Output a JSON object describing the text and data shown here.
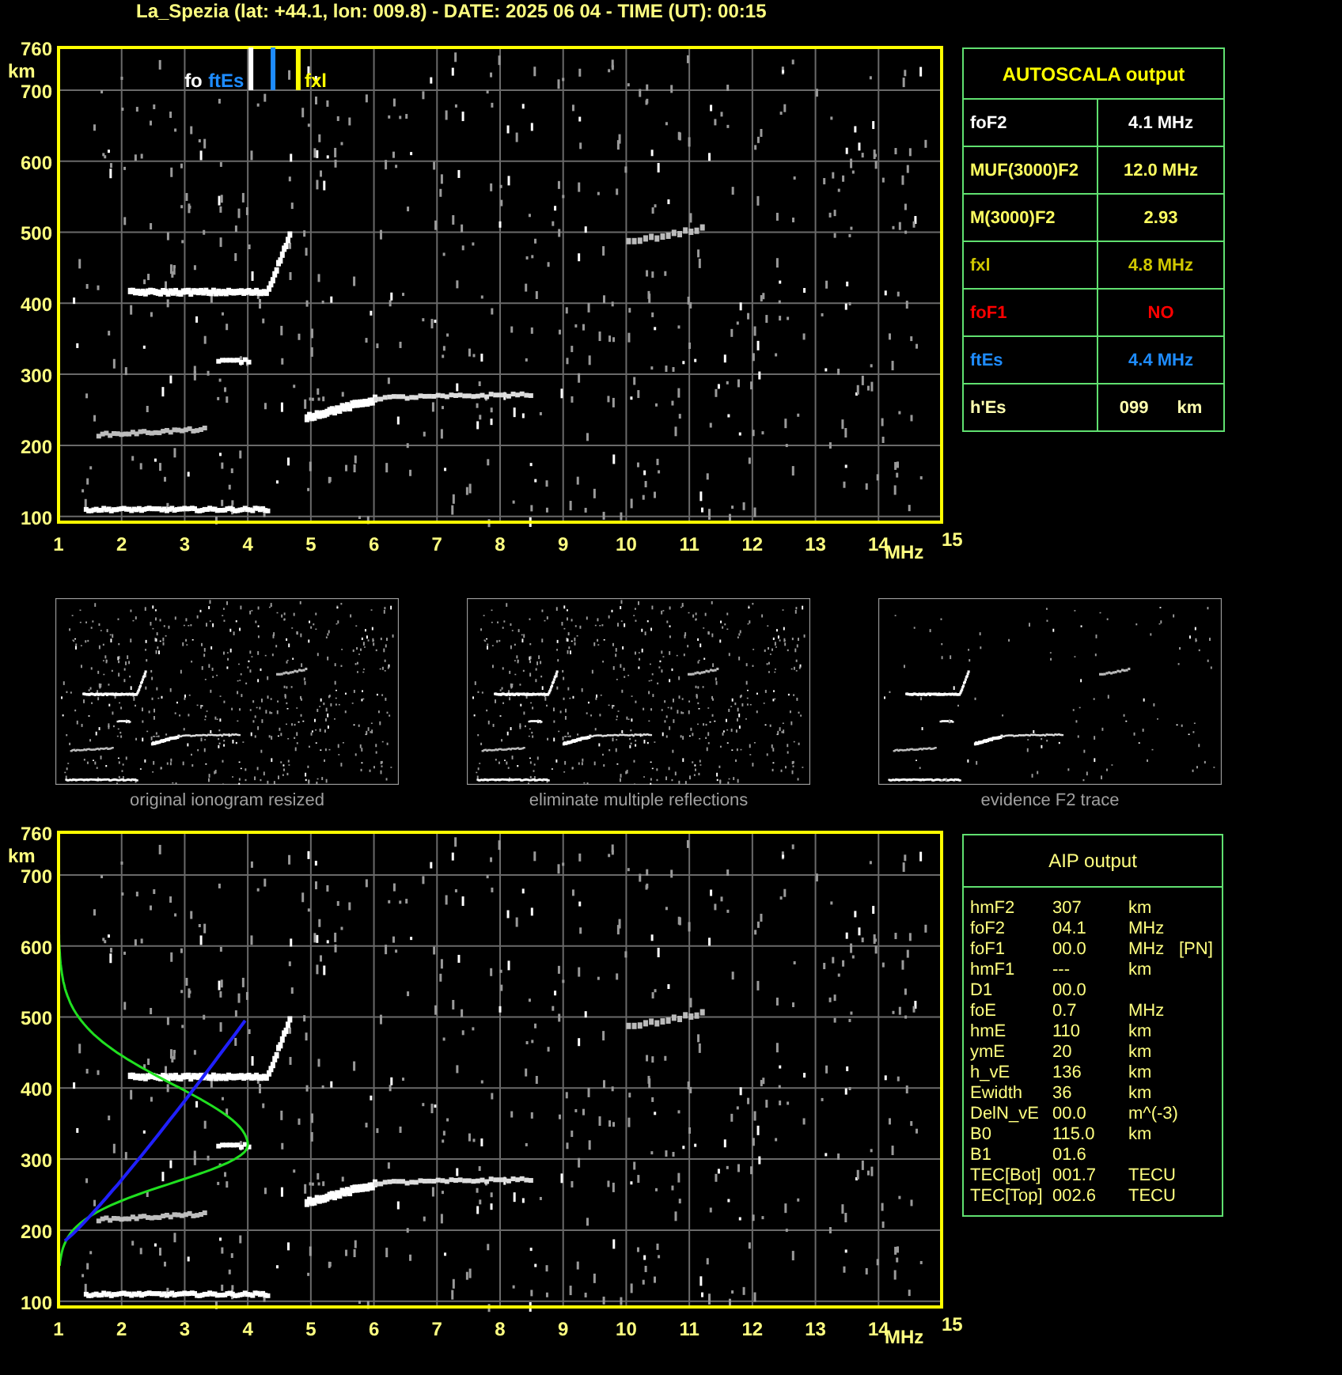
{
  "title": "La_Spezia (lat: +44.1, lon: 009.8) - DATE: 2025 06 04 - TIME (UT): 00:15",
  "ionograms": [
    {
      "kind": "scaled",
      "y_unit": "km",
      "x_unit": "MHz",
      "y_ticks": [
        "760",
        "700",
        "600",
        "500",
        "400",
        "300",
        "200",
        "100"
      ],
      "x_ticks": [
        "1",
        "2",
        "3",
        "4",
        "5",
        "6",
        "7",
        "8",
        "9",
        "10",
        "11",
        "12",
        "13",
        "14",
        "15"
      ],
      "markers": [
        {
          "label": "fo",
          "color": "#ffffff"
        },
        {
          "label": "ftEs",
          "color": "#1e8cff"
        },
        {
          "label": "fxl",
          "color": "#ffff00"
        }
      ]
    },
    {
      "kind": "profile",
      "y_unit": "km",
      "x_unit": "MHz",
      "y_ticks": [
        "760",
        "700",
        "600",
        "500",
        "400",
        "300",
        "200",
        "100"
      ],
      "x_ticks": [
        "1",
        "2",
        "3",
        "4",
        "5",
        "6",
        "7",
        "8",
        "9",
        "10",
        "11",
        "12",
        "13",
        "14",
        "15"
      ]
    }
  ],
  "autoscala": {
    "title": "AUTOSCALA output",
    "rows": [
      {
        "label": "foF2",
        "value": "4.1 MHz",
        "color": "#ffffff"
      },
      {
        "label": "MUF(3000)F2",
        "value": "12.0 MHz",
        "color": "#ffff60"
      },
      {
        "label": "M(3000)F2",
        "value": "2.93",
        "color": "#ffff60"
      },
      {
        "label": "fxl",
        "value": "4.8 MHz",
        "color": "#d0c800"
      },
      {
        "label": "foF1",
        "value": "NO",
        "color": "#ff0000"
      },
      {
        "label": "ftEs",
        "value": "4.4 MHz",
        "color": "#1e8cff"
      },
      {
        "label": "h'Es",
        "value": "099",
        "unit": "km",
        "color": "#ffffb0"
      }
    ]
  },
  "thumbnails": [
    {
      "kind": "full",
      "caption": "original ionogram resized"
    },
    {
      "kind": "full",
      "caption": "eliminate multiple reflections"
    },
    {
      "kind": "trace",
      "caption": "evidence F2 trace"
    }
  ],
  "aip": {
    "title": "AIP output",
    "rows": [
      {
        "name": "hmF2",
        "value": "307",
        "unit": "km"
      },
      {
        "name": "foF2",
        "value": "04.1",
        "unit": "MHz"
      },
      {
        "name": "foF1",
        "value": "00.0",
        "unit": "MHz",
        "note": "[PN]"
      },
      {
        "name": "hmF1",
        "value": "---",
        "unit": "km"
      },
      {
        "name": "D1",
        "value": "00.0"
      },
      {
        "name": "foE",
        "value": "0.7",
        "unit": "MHz"
      },
      {
        "name": "hmE",
        "value": "110",
        "unit": "km"
      },
      {
        "name": "ymE",
        "value": "20",
        "unit": "km"
      },
      {
        "name": "h_vE",
        "value": "136",
        "unit": "km"
      },
      {
        "name": "Ewidth",
        "value": "36",
        "unit": "km"
      },
      {
        "name": "DelN_vE",
        "value": "00.0",
        "unit": "m^(-3)"
      },
      {
        "name": "B0",
        "value": "115.0",
        "unit": "km"
      },
      {
        "name": "B1",
        "value": "01.6"
      },
      {
        "name": "TEC[Bot]",
        "value": "001.7",
        "unit": "TECU"
      },
      {
        "name": "TEC[Top]",
        "value": "002.6",
        "unit": "TECU"
      }
    ]
  }
}
